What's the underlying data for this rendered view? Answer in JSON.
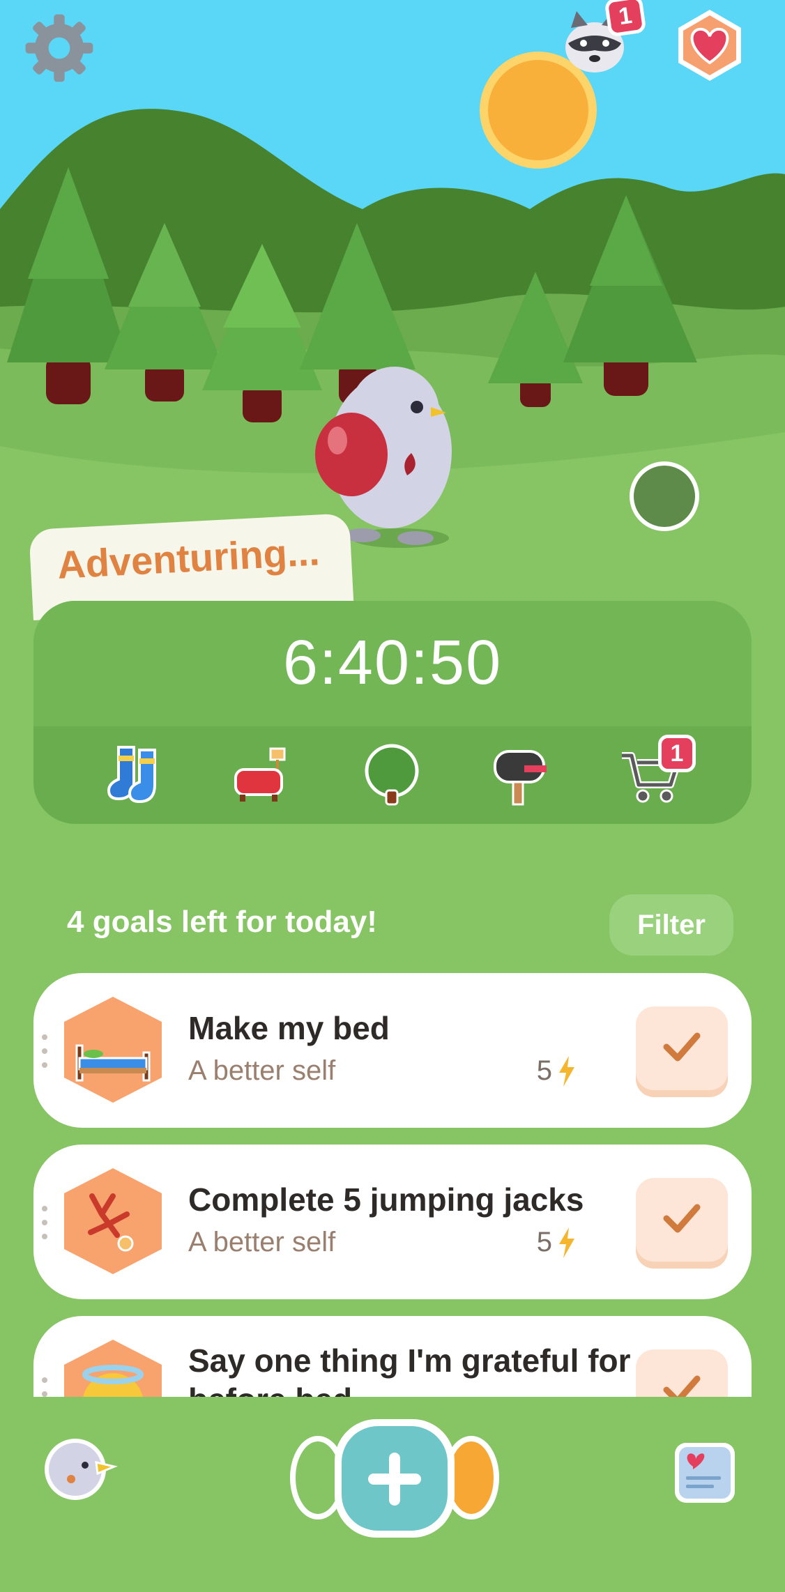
{
  "header": {
    "settings_icon": "gear-icon",
    "character_icon": "raccoon-icon",
    "character_badge": "1",
    "favorites_icon": "heart-icon"
  },
  "adventure": {
    "status_label": "Adventuring...",
    "timer": "6:40:50",
    "shortcuts": [
      {
        "icon": "socks-icon"
      },
      {
        "icon": "sofa-icon"
      },
      {
        "icon": "tree-icon"
      },
      {
        "icon": "mailbox-icon"
      },
      {
        "icon": "shopping-cart-icon",
        "badge": "1"
      }
    ]
  },
  "goals": {
    "summary": "4 goals left for today!",
    "filter_label": "Filter",
    "items": [
      {
        "title": "Make my bed",
        "category": "A better self",
        "points": "5",
        "icon": "bed-icon"
      },
      {
        "title": "Complete 5 jumping jacks",
        "category": "A better self",
        "points": "5",
        "icon": "jumping-person-icon"
      },
      {
        "title": "Say one thing I'm grateful for before bed",
        "category": "",
        "points": "",
        "icon": "halo-face-icon"
      }
    ]
  },
  "bottom_nav": {
    "left_icon": "bird-avatar-icon",
    "center_icon": "plus-icon",
    "right_icon": "journal-icon"
  },
  "colors": {
    "sky": "#5ad6f6",
    "grass": "#86c464",
    "accent_orange": "#e08342",
    "add_button": "#6fc6c8"
  }
}
